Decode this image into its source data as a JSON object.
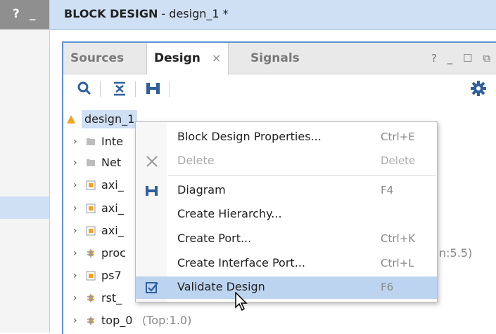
{
  "left_panel": {
    "help": "?",
    "minimize": "_"
  },
  "header": {
    "title_bold": "BLOCK DESIGN",
    "title_rest": " - design_1 *"
  },
  "tabs": [
    {
      "label": "Sources"
    },
    {
      "label": "Design",
      "close": "×"
    },
    {
      "label": "Signals"
    }
  ],
  "window_controls": {
    "help": "?",
    "minimize": "_",
    "maximize": "☐",
    "float": "⧉"
  },
  "tree": {
    "root": "design_1",
    "items": [
      {
        "label": "Inte",
        "suffix": ""
      },
      {
        "label": "Net",
        "suffix": ""
      },
      {
        "label": "axi_",
        "suffix": ""
      },
      {
        "label": "axi_",
        "suffix": ""
      },
      {
        "label": "axi_",
        "suffix": ""
      },
      {
        "label": "proc",
        "suffix": "n:5.5)"
      },
      {
        "label": "ps7",
        "suffix": ""
      },
      {
        "label": "rst_",
        "suffix": ""
      },
      {
        "label": "top_0",
        "suffix": "(Top:1.0)"
      }
    ]
  },
  "context_menu": {
    "items": [
      {
        "label": "Block Design Properties...",
        "shortcut": "Ctrl+E"
      },
      {
        "label": "Delete",
        "shortcut": "Delete",
        "disabled": true
      },
      {
        "label": "Diagram",
        "shortcut": "F4"
      },
      {
        "label": "Create Hierarchy...",
        "shortcut": ""
      },
      {
        "label": "Create Port...",
        "shortcut": "Ctrl+K"
      },
      {
        "label": "Create Interface Port...",
        "shortcut": "Ctrl+L"
      },
      {
        "label": "Validate Design",
        "shortcut": "F6",
        "highlighted": true
      }
    ]
  },
  "colors": {
    "accent": "#5f92d4",
    "header_bg": "#cfe0f5",
    "highlight": "#bcd4f0"
  }
}
